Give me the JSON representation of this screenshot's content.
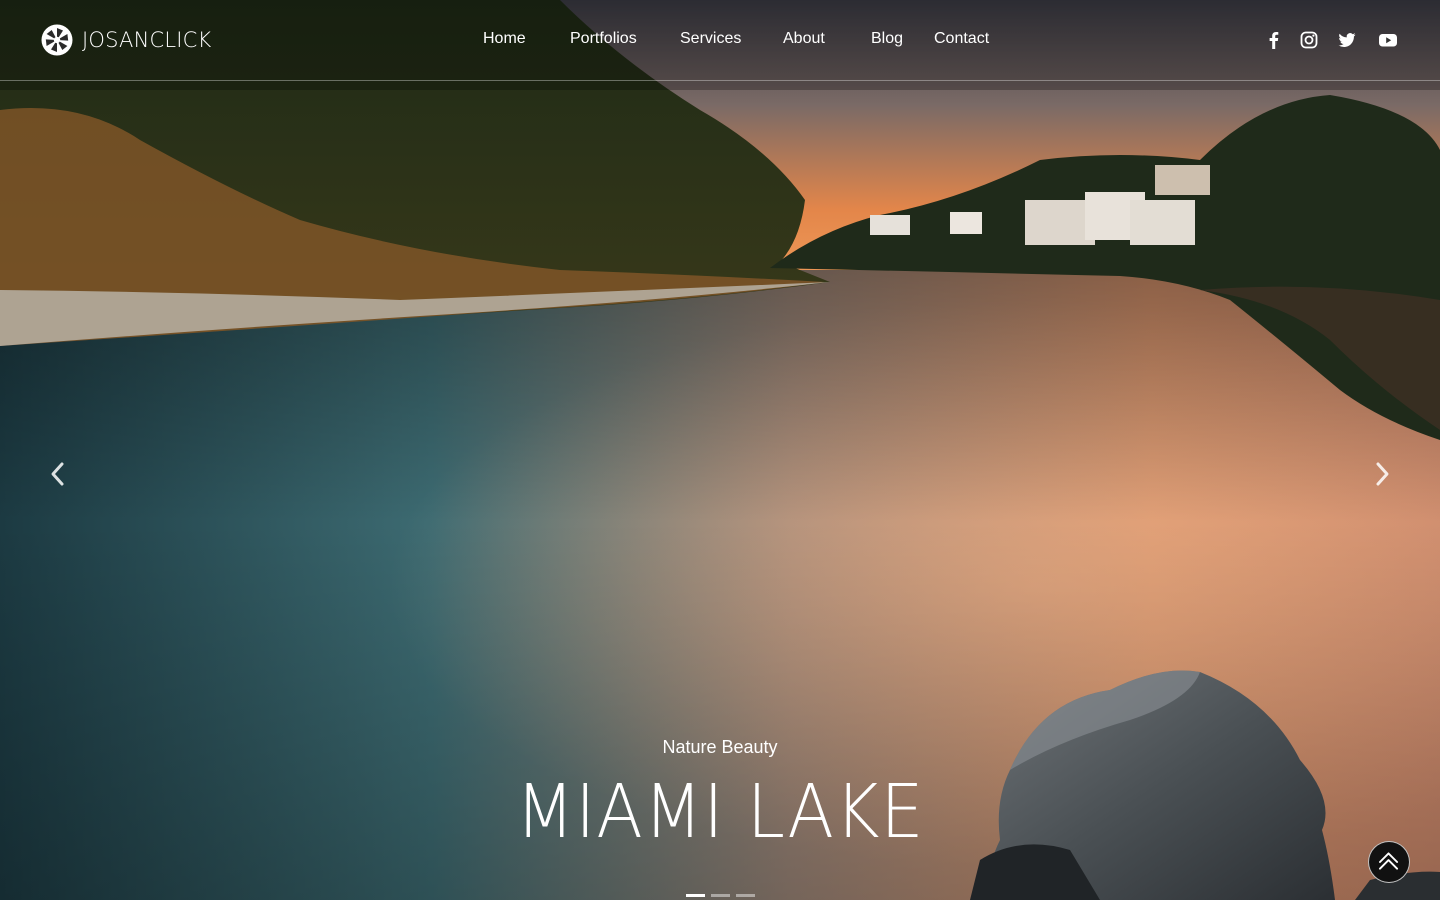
{
  "brand": {
    "name": "JOSANCLICK",
    "logo_icon": "camera-shutter-icon"
  },
  "nav": {
    "items": [
      {
        "label": "Home"
      },
      {
        "label": "Portfolios"
      },
      {
        "label": "Services"
      },
      {
        "label": "About"
      },
      {
        "label": "Blog"
      },
      {
        "label": "Contact"
      }
    ]
  },
  "social": {
    "icons": [
      "facebook-icon",
      "instagram-icon",
      "twitter-icon",
      "youtube-icon"
    ]
  },
  "slider": {
    "subtitle": "Nature Beauty",
    "title": "MIAMI LAKE",
    "slide_count": 3,
    "active_slide": 1,
    "prev_icon": "chevron-left-icon",
    "next_icon": "chevron-right-icon"
  },
  "back_to_top": {
    "icon": "double-chevron-up-icon"
  },
  "colors": {
    "text": "#ffffff",
    "sky_glow": "#f08a3a",
    "water_teal": "#2f5f66"
  }
}
